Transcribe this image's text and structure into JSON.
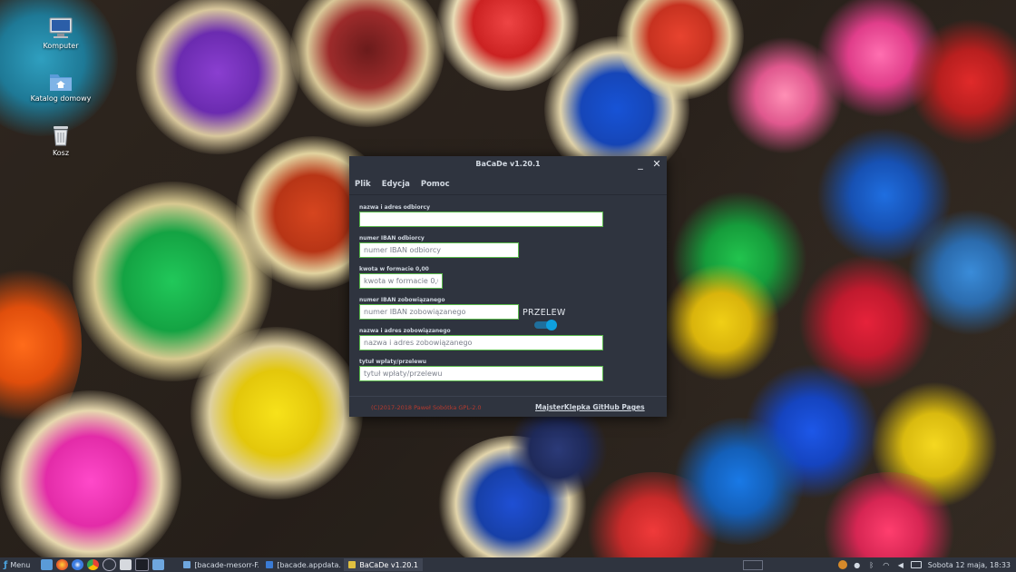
{
  "desktop": {
    "icons": [
      {
        "label": "Komputer"
      },
      {
        "label": "Katalog domowy"
      },
      {
        "label": "Kosz"
      }
    ]
  },
  "window": {
    "title": "BaCaDe v1.20.1",
    "minimize_glyph": "_",
    "close_glyph": "✕",
    "menu": [
      "Plik",
      "Edycja",
      "Pomoc"
    ],
    "fields": {
      "recipient": {
        "label": "nazwa i adres odbiorcy",
        "value": "",
        "placeholder": ""
      },
      "recipient_iban": {
        "label": "numer IBAN odbiorcy",
        "value": "",
        "placeholder": "numer IBAN odbiorcy"
      },
      "amount": {
        "label": "kwota w formacie 0,00",
        "value": "",
        "placeholder": "kwota w formacie 0,00"
      },
      "payer_iban": {
        "label": "numer IBAN zobowiązanego",
        "value": "",
        "placeholder": "numer IBAN zobowiązanego"
      },
      "payer": {
        "label": "nazwa i adres zobowiązanego",
        "value": "",
        "placeholder": "nazwa i adres zobowiązanego"
      },
      "transfer_title": {
        "label": "tytuł wpłaty/przelewu",
        "value": "",
        "placeholder": "tytuł wpłaty/przelewu"
      }
    },
    "mode_label": "PRZELEW",
    "mode_toggle_on": true,
    "footer": {
      "copyright": "(C)2017-2018 Paweł Sobótka GPL-2.0",
      "link": "MajsterKlepka GitHub Pages"
    },
    "accent_color": "#59b94b",
    "toggle_color": "#0ea0df",
    "copyright_color": "#b63a2e"
  },
  "taskbar": {
    "menu_label": "Menu",
    "tasks": [
      {
        "label": "[bacade-mesorr-F...",
        "active": false
      },
      {
        "label": "[bacade.appdata...",
        "active": false
      },
      {
        "label": "BaCaDe v1.20.1",
        "active": true
      }
    ],
    "clock": "Sobota 12 maja, 18:33"
  }
}
